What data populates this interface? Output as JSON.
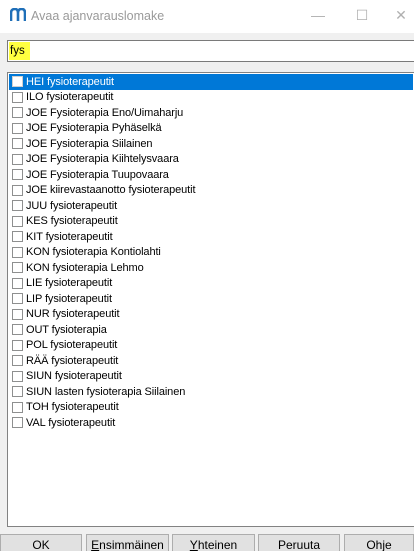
{
  "window": {
    "title": "Avaa ajanvarauslomake",
    "app_icon": "m-logo-icon",
    "controls": {
      "minimize": "—",
      "maximize": "☐",
      "close": "✕"
    }
  },
  "search": {
    "value": "fys",
    "highlight_color": "#ffff40"
  },
  "list": {
    "selected_color": "#0078d7",
    "items": [
      {
        "label": "HEI fysioterapeutit",
        "selected": true
      },
      {
        "label": "ILO fysioterapeutit",
        "selected": false
      },
      {
        "label": "JOE Fysioterapia Eno/Uimaharju",
        "selected": false
      },
      {
        "label": "JOE Fysioterapia Pyhäselkä",
        "selected": false
      },
      {
        "label": "JOE Fysioterapia Siilainen",
        "selected": false
      },
      {
        "label": "JOE Fysioterapia Kiihtelysvaara",
        "selected": false
      },
      {
        "label": "JOE Fysioterapia Tuupovaara",
        "selected": false
      },
      {
        "label": "JOE kiirevastaanotto fysioterapeutit",
        "selected": false
      },
      {
        "label": "JUU fysioterapeutit",
        "selected": false
      },
      {
        "label": "KES fysioterapeutit",
        "selected": false
      },
      {
        "label": "KIT fysioterapeutit",
        "selected": false
      },
      {
        "label": "KON fysioterapia Kontiolahti",
        "selected": false
      },
      {
        "label": "KON fysioterapia Lehmo",
        "selected": false
      },
      {
        "label": "LIE fysioterapeutit",
        "selected": false
      },
      {
        "label": "LIP fysioterapeutit",
        "selected": false
      },
      {
        "label": "NUR fysioterapeutit",
        "selected": false
      },
      {
        "label": "OUT fysioterapia",
        "selected": false
      },
      {
        "label": "POL fysioterapeutit",
        "selected": false
      },
      {
        "label": "RÄÄ fysioterapeutit",
        "selected": false
      },
      {
        "label": "SIUN fysioterapeutit",
        "selected": false
      },
      {
        "label": "SIUN lasten fysioterapia Siilainen",
        "selected": false
      },
      {
        "label": "TOH fysioterapeutit",
        "selected": false
      },
      {
        "label": "VAL fysioterapeutit",
        "selected": false
      }
    ]
  },
  "buttons": {
    "ok": "OK",
    "first": {
      "mnemonic": "E",
      "rest": "nsimmäinen"
    },
    "common": {
      "mnemonic": "Y",
      "rest": "hteinen"
    },
    "cancel": "Peruuta",
    "help": "Ohje"
  }
}
